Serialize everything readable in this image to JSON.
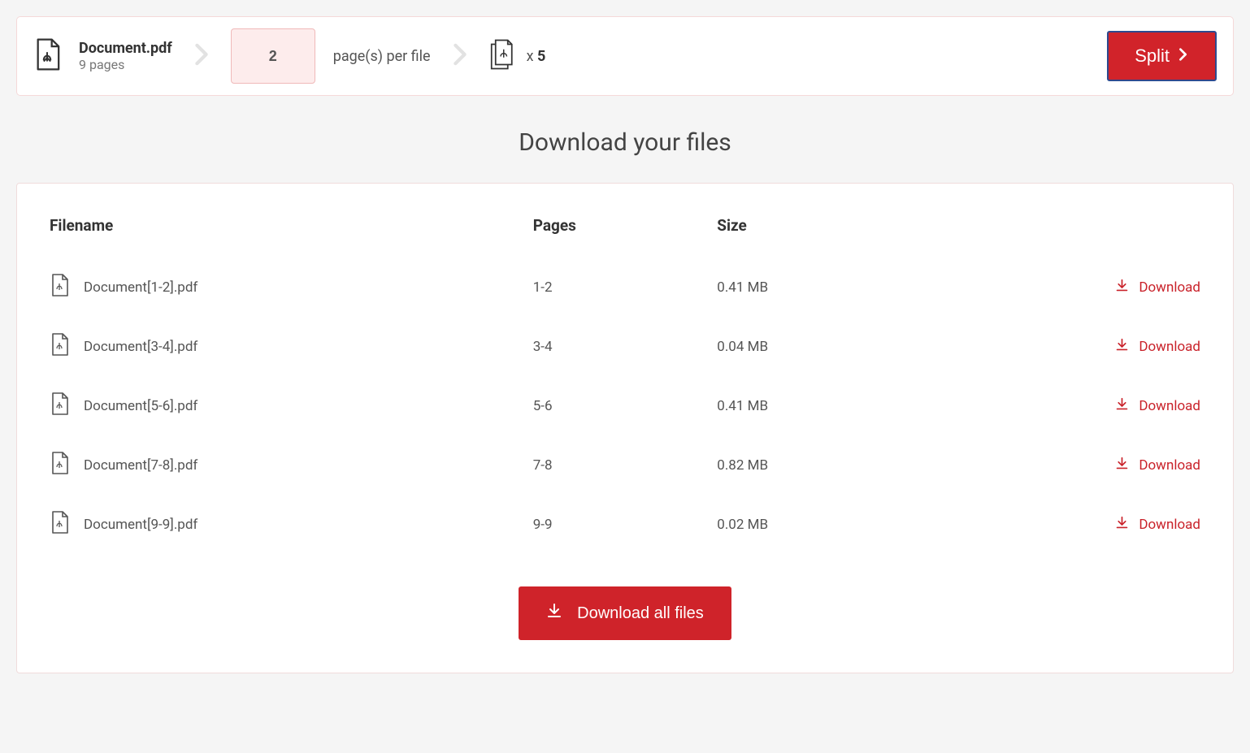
{
  "topBar": {
    "docName": "Document.pdf",
    "docPages": "9 pages",
    "pagesPerFile": "2",
    "perFileLabel": "page(s) per file",
    "countPrefix": "x ",
    "count": "5",
    "splitLabel": "Split"
  },
  "mainTitle": "Download your files",
  "table": {
    "headers": {
      "filename": "Filename",
      "pages": "Pages",
      "size": "Size"
    },
    "downloadLabel": "Download",
    "rows": [
      {
        "name": "Document[1-2].pdf",
        "pages": "1-2",
        "size": "0.41 MB"
      },
      {
        "name": "Document[3-4].pdf",
        "pages": "3-4",
        "size": "0.04 MB"
      },
      {
        "name": "Document[5-6].pdf",
        "pages": "5-6",
        "size": "0.41 MB"
      },
      {
        "name": "Document[7-8].pdf",
        "pages": "7-8",
        "size": "0.82 MB"
      },
      {
        "name": "Document[9-9].pdf",
        "pages": "9-9",
        "size": "0.02 MB"
      }
    ]
  },
  "downloadAllLabel": "Download all files"
}
